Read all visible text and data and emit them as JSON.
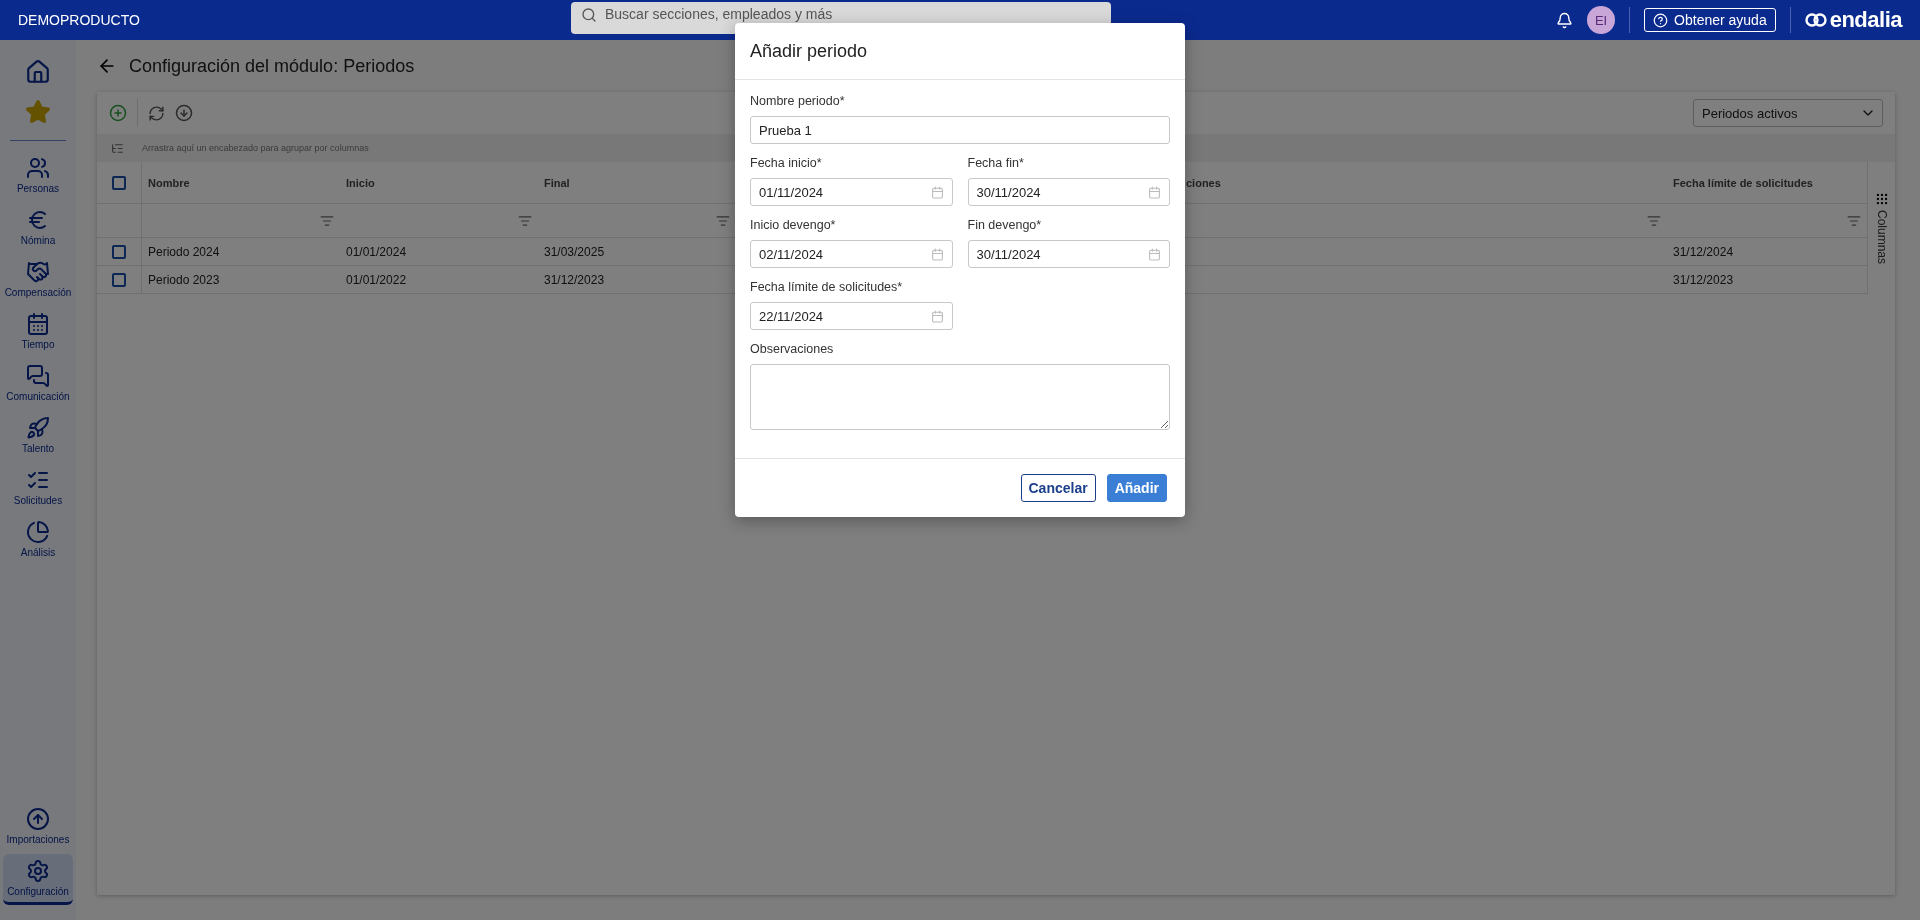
{
  "topbar": {
    "brand": "DEMOPRODUCTO",
    "search": {
      "placeholder": "Buscar secciones, empleados y más"
    },
    "avatar": "EI",
    "help": "Obtener ayuda",
    "logo": "endalia"
  },
  "sidebar": {
    "items": [
      {
        "label": "Personas",
        "selected": false
      },
      {
        "label": "Nómina",
        "selected": false
      },
      {
        "label": "Compensación",
        "selected": false
      },
      {
        "label": "Tiempo",
        "selected": false
      },
      {
        "label": "Comunicación",
        "selected": false
      },
      {
        "label": "Talento",
        "selected": false
      },
      {
        "label": "Solicitudes",
        "selected": false
      },
      {
        "label": "Análisis",
        "selected": false
      }
    ],
    "bottom_items": [
      {
        "label": "Importaciones",
        "selected": false
      },
      {
        "label": "Configuración",
        "selected": true
      }
    ]
  },
  "page": {
    "title": "Configuración del módulo: Periodos"
  },
  "toolbar": {
    "filter": "Periodos activos"
  },
  "table": {
    "group_hint": "Arrastra aquí un encabezado para agrupar por columnas",
    "header_checked": false,
    "columns": [
      "Nombre",
      "Inicio",
      "Final",
      "ciones",
      "Fecha límite de solicitudes"
    ],
    "rows": [
      {
        "checked": false,
        "cells": [
          "Periodo 2024",
          "01/01/2024",
          "31/03/2025",
          "",
          "31/12/2024"
        ]
      },
      {
        "checked": false,
        "cells": [
          "Periodo 2023",
          "01/01/2022",
          "31/12/2023",
          "",
          "31/12/2023"
        ]
      }
    ],
    "columns_panel": "Columnas"
  },
  "dialog": {
    "title": "Añadir periodo",
    "fields": [
      {
        "kind": "text",
        "label": "Nombre periodo*",
        "value": "Prueba 1"
      },
      {
        "kind": "date",
        "label": "Fecha inicio*",
        "value": "01/11/2024"
      },
      {
        "kind": "date",
        "label": "Fecha fin*",
        "value": "30/11/2024"
      },
      {
        "kind": "date",
        "label": "Inicio devengo*",
        "value": "02/11/2024"
      },
      {
        "kind": "date",
        "label": "Fin devengo*",
        "value": "30/11/2024"
      },
      {
        "kind": "date",
        "label": "Fecha límite de solicitudes*",
        "value": "22/11/2024"
      },
      {
        "kind": "textarea",
        "label": "Observaciones"
      }
    ],
    "buttons": [
      {
        "kind": "secondary",
        "label": "Cancelar"
      },
      {
        "kind": "primary",
        "label": "Añadir"
      }
    ]
  }
}
